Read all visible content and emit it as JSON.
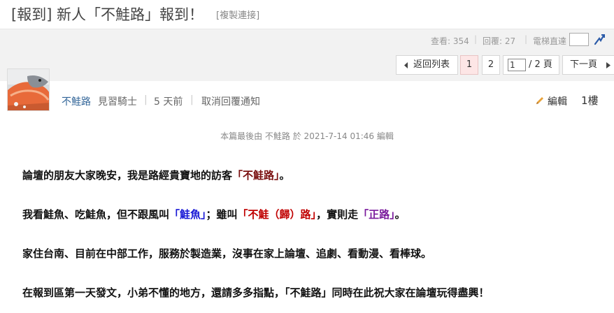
{
  "thread": {
    "title": "[報到] 新人「不鮭路」報到！",
    "copy_link": "[複製連接]"
  },
  "stats": {
    "views_label": "查看: 354",
    "replies_label": "回覆: 27",
    "jump_label": "電梯直達"
  },
  "pager": {
    "back_label": "返回列表",
    "pages": [
      "1",
      "2"
    ],
    "current_page_input": "1",
    "of_label": "/ 2 頁",
    "next_label": "下一頁"
  },
  "post": {
    "author": "不鮭路",
    "rank": "見習騎士",
    "time": "5 天前",
    "unsubscribe": "取消回覆通知",
    "edit_label": "編輯",
    "floor": "1樓",
    "last_edit": "本篇最後由 不鮭路 於 2021-7-14 01:46 編輯"
  },
  "body": {
    "p1_a": "論壇的朋友大家晚安，我是路經貴寶地的訪客",
    "p1_b": "「不鮭路」",
    "p1_c": "。",
    "p2_a": "我看鮭魚、吃鮭魚，但不跟風叫",
    "p2_b": "「鮭魚」",
    "p2_c": "；雖叫",
    "p2_d": "「不鮭（歸）路」",
    "p2_e": "，實則走",
    "p2_f": "「正路」",
    "p2_g": "。",
    "p3": "家住台南、目前在中部工作，服務於製造業，沒事在家上論壇、追劇、看動漫、看棒球。",
    "p4": "在報到區第一天發文，小弟不懂的地方，還請多多指點，「不鮭路」同時在此祝大家在論壇玩得盡興！"
  },
  "colors": {
    "red": "#c00000",
    "blue": "#1a1ad6",
    "purple": "#7a1a9c",
    "author": "#336699"
  },
  "icons": [
    "left-arrow-icon",
    "right-arrow-icon",
    "jump-icon",
    "pencil-icon"
  ]
}
